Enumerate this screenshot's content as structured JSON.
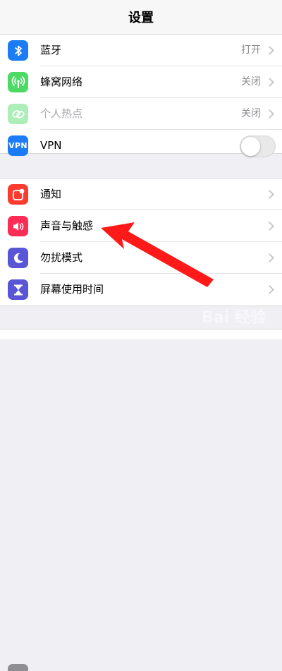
{
  "header": {
    "title": "设置"
  },
  "group1": {
    "bluetooth": {
      "label": "蓝牙",
      "value": "打开",
      "icon": "bluetooth-icon",
      "color": "#1b7cf5"
    },
    "cellular": {
      "label": "蜂窝网络",
      "value": "关闭",
      "icon": "cellular-antenna-icon",
      "color": "#4cd964"
    },
    "hotspot": {
      "label": "个人热点",
      "value": "关闭",
      "icon": "chain-link-icon",
      "color": "#4cd964"
    },
    "vpn": {
      "label": "VPN",
      "icon_text": "VPN",
      "color": "#1b7cf5",
      "toggle_on": false
    }
  },
  "group2": {
    "notifications": {
      "label": "通知",
      "icon": "notification-badge-icon",
      "color": "#ff3b30"
    },
    "sounds": {
      "label": "声音与触感",
      "icon": "speaker-icon",
      "color": "#ff2d55"
    },
    "dnd": {
      "label": "勿扰模式",
      "icon": "moon-icon",
      "color": "#5856d6"
    },
    "screentime": {
      "label": "屏幕使用时间",
      "icon": "hourglass-icon",
      "color": "#5856d6"
    }
  },
  "annotation": {
    "color": "#ff1a1a"
  }
}
